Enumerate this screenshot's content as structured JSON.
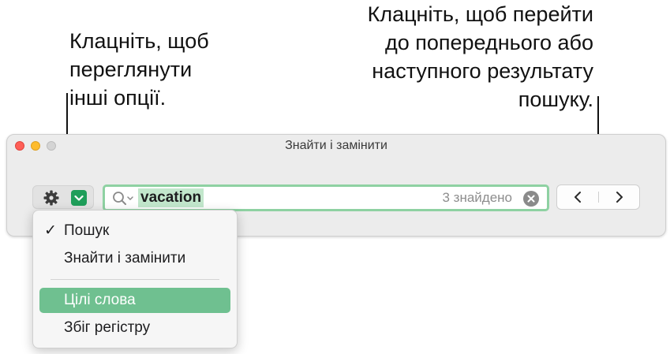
{
  "callouts": {
    "left": [
      "Клацніть, щоб",
      "переглянути",
      "інші опції."
    ],
    "right": [
      "Клацніть, щоб перейти",
      "до попереднього або",
      "наступного результату",
      "пошуку."
    ]
  },
  "window": {
    "title": "Знайти і замінити"
  },
  "search": {
    "query": "vacation",
    "result_count": "3 знайдено"
  },
  "menu": {
    "items": [
      {
        "label": "Пошук",
        "checked": true,
        "selected": false
      },
      {
        "label": "Знайти і замінити",
        "checked": false,
        "selected": false
      },
      {
        "label": "Цілі слова",
        "checked": false,
        "selected": true
      },
      {
        "label": "Збіг регістру",
        "checked": false,
        "selected": false
      }
    ],
    "check_mark": "✓"
  },
  "colors": {
    "accent_green": "#1f9e5a",
    "highlight": "#c2e7cc",
    "field_focus_ring": "#8ed1a2",
    "menu_selection": "#6fc090"
  },
  "icons": [
    "gear-icon",
    "chevron-down-icon",
    "search-icon",
    "clear-icon",
    "chevron-left-icon",
    "chevron-right-icon"
  ]
}
